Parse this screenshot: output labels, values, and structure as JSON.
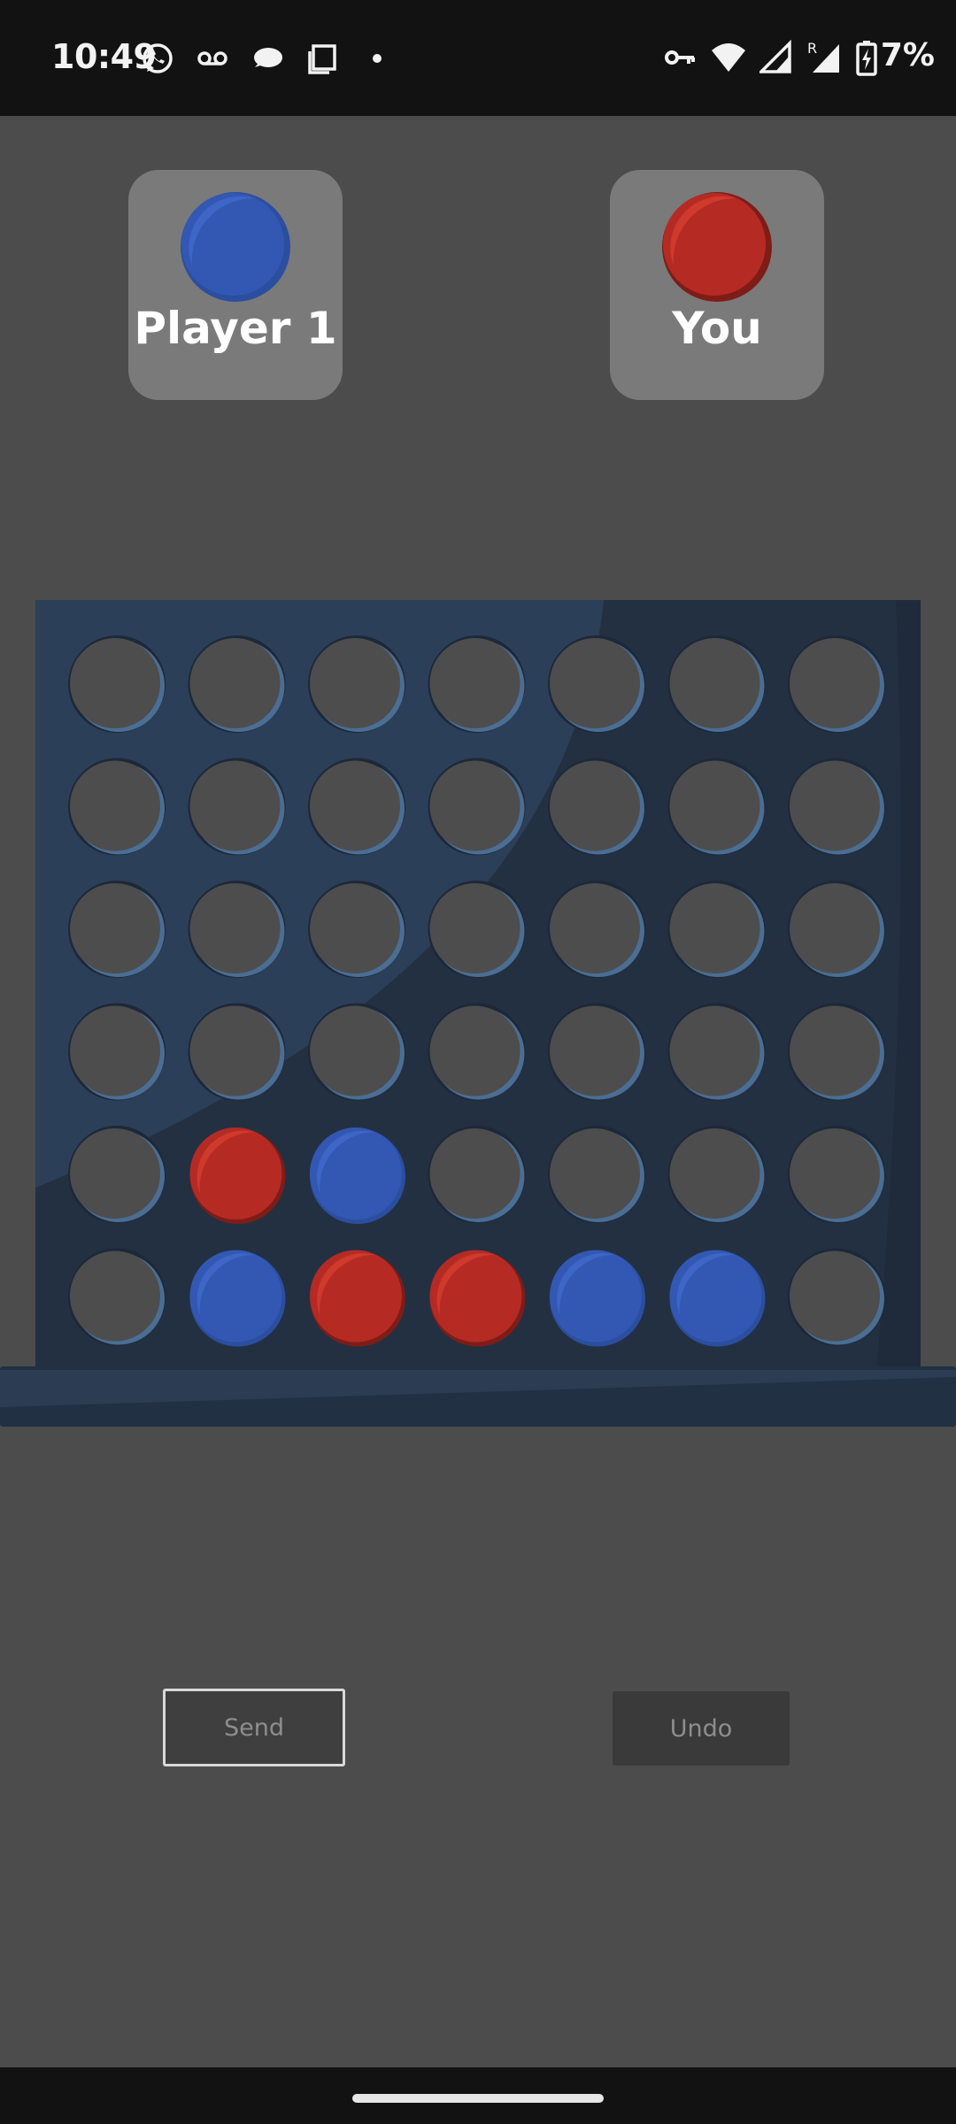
{
  "status_bar": {
    "time": "10:49",
    "battery": "7%",
    "left_icons": [
      "whatsapp-icon",
      "voicemail-icon",
      "chat-bubble-icon",
      "screenshot-icon",
      "dot-icon"
    ],
    "right_icons": [
      "vpn-key-icon",
      "wifi-icon",
      "signal-icon",
      "signal-roaming-icon",
      "battery-charging-icon"
    ],
    "roaming_letter": "R"
  },
  "players": [
    {
      "name": "Player 1",
      "color": "blue"
    },
    {
      "name": "You",
      "color": "red"
    }
  ],
  "colors": {
    "background": "#4c4c4c",
    "board": "#2a3a50",
    "blue_disc": "#3358b4",
    "red_disc": "#b52b24",
    "empty_slot": "#4d4d4d",
    "card": "#7a7a7a"
  },
  "board": {
    "rows": 6,
    "cols": 7,
    "grid": [
      [
        "",
        "",
        "",
        "",
        "",
        "",
        ""
      ],
      [
        "",
        "",
        "",
        "",
        "",
        "",
        ""
      ],
      [
        "",
        "",
        "",
        "",
        "",
        "",
        ""
      ],
      [
        "",
        "",
        "",
        "",
        "",
        "",
        ""
      ],
      [
        "",
        "red",
        "blue",
        "",
        "",
        "",
        ""
      ],
      [
        "",
        "blue",
        "red",
        "red",
        "blue",
        "blue",
        ""
      ]
    ]
  },
  "buttons": {
    "send": "Send",
    "undo": "Undo"
  }
}
